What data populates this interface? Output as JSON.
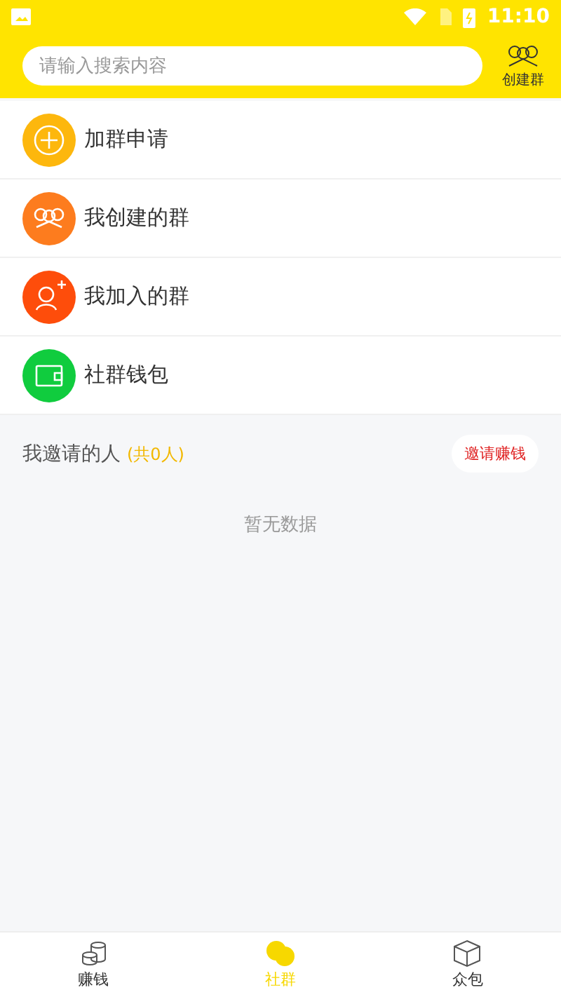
{
  "status_bar": {
    "time": "11:10"
  },
  "header": {
    "search": {
      "placeholder": "请输入搜索内容"
    },
    "create_group": {
      "label": "创建群"
    }
  },
  "menu": [
    {
      "kind": "plus",
      "label": "加群申请",
      "color": "#fdb70d"
    },
    {
      "kind": "group",
      "label": "我创建的群",
      "color": "#fd7c1e"
    },
    {
      "kind": "join",
      "label": "我加入的群",
      "color": "#fe4d0b"
    },
    {
      "kind": "wallet",
      "label": "社群钱包",
      "color": "#10cc3e"
    }
  ],
  "invited": {
    "title": "我邀请的人",
    "count": "(共0人)",
    "button": "邀请赚钱",
    "empty": "暂无数据"
  },
  "tabs": [
    {
      "kind": "coins",
      "label": "赚钱",
      "selected": false
    },
    {
      "kind": "chat",
      "label": "社群",
      "selected": true
    },
    {
      "kind": "box",
      "label": "众包",
      "selected": false
    }
  ]
}
